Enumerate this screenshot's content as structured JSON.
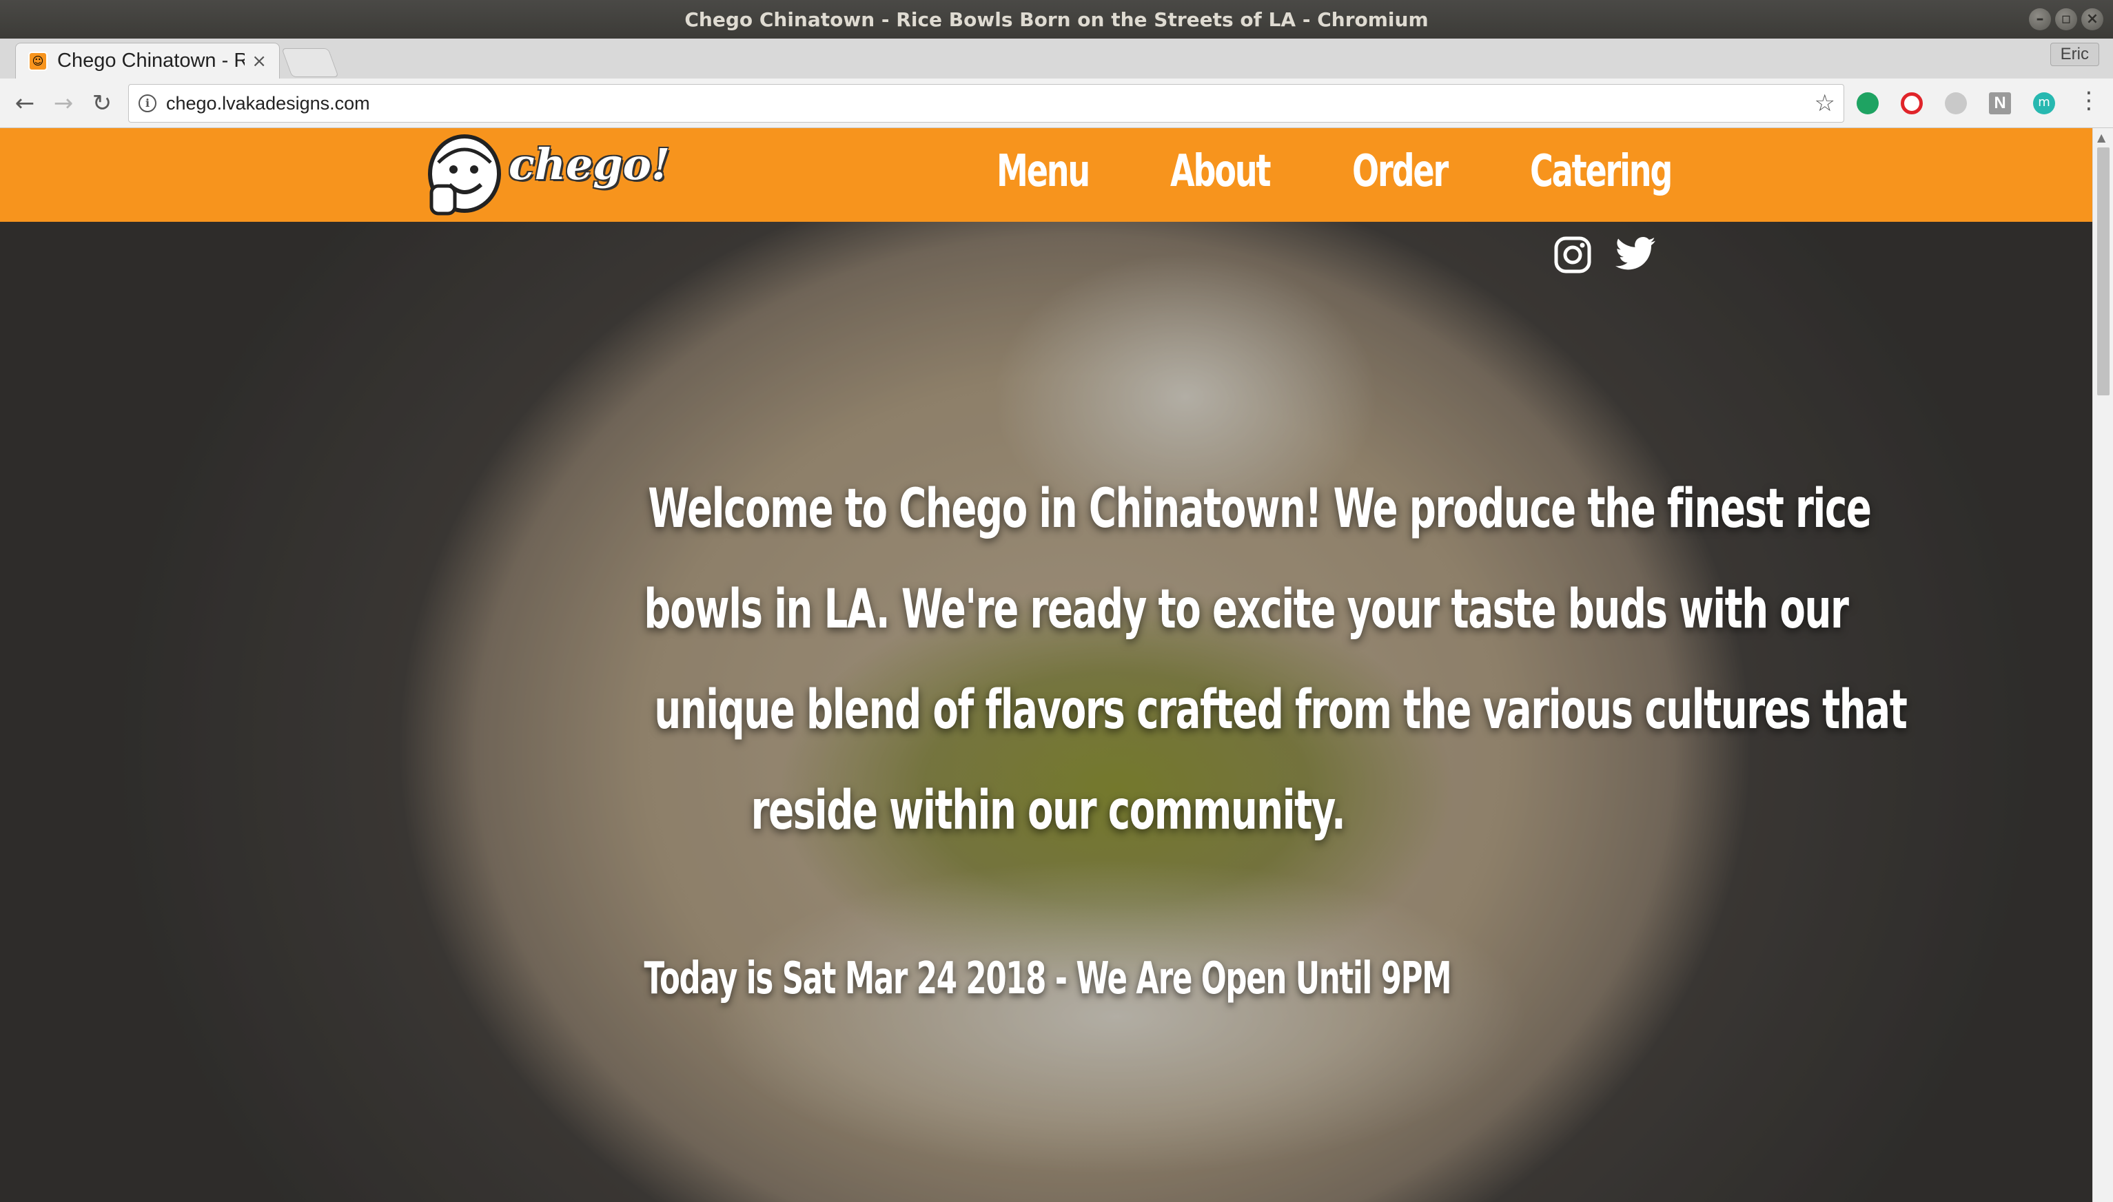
{
  "window": {
    "title": "Chego Chinatown - Rice Bowls Born on the Streets of LA - Chromium",
    "controls": [
      "minimize",
      "maximize",
      "close"
    ]
  },
  "tabs": [
    {
      "title": "Chego Chinatown - Rice Bowls Born on the Streets of LA",
      "close": "×"
    }
  ],
  "profile": {
    "name": "Eric"
  },
  "toolbar": {
    "back": "←",
    "forward": "→",
    "reload": "↻",
    "url": "chego.lvakadesigns.com",
    "star": "☆",
    "ext_n": "N",
    "ext_m": "m",
    "menu": "⋮"
  },
  "site": {
    "logo_text": "chego!",
    "nav": [
      "Menu",
      "About",
      "Order",
      "Catering"
    ],
    "social": [
      "instagram-icon",
      "twitter-icon"
    ],
    "hero_lines": [
      "Welcome to Chego in Chinatown! We produce the finest rice",
      "bowls in LA. We're ready to excite your taste buds with our",
      "unique blend of flavors crafted from the various cultures that",
      "reside within our community."
    ],
    "hero_date": "Today is Sat Mar 24 2018 - We Are Open Until 9PM"
  },
  "colors": {
    "header_orange": "#f7941d",
    "titlebar": "#3c3b37",
    "text_white": "#ffffff"
  }
}
